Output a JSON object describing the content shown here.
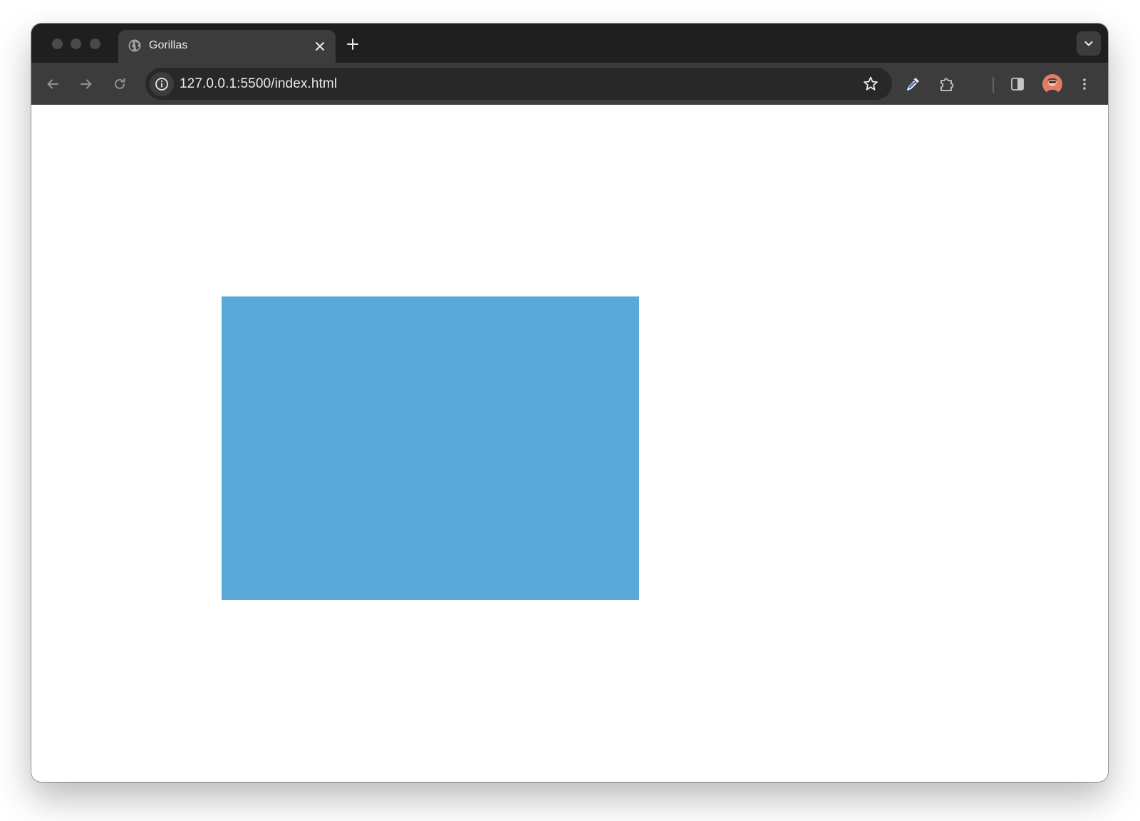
{
  "window": {
    "traffic_lights": [
      "close",
      "minimize",
      "maximize"
    ]
  },
  "tabs": [
    {
      "title": "Gorillas",
      "icon": "globe-icon",
      "active": true
    }
  ],
  "tabstrip": {
    "new_tab_icon": "plus-icon",
    "tab_search_icon": "chevron-down-icon"
  },
  "toolbar": {
    "back_icon": "arrow-left-icon",
    "forward_icon": "arrow-right-icon",
    "reload_icon": "reload-icon",
    "site_info_icon": "info-icon",
    "url": "127.0.0.1:5500/index.html",
    "bookmark_icon": "star-icon",
    "extensions": [
      "eyedropper-icon",
      "puzzle-icon"
    ],
    "side_panel_icon": "side-panel-icon",
    "profile": "avatar",
    "menu_icon": "kebab-menu-icon"
  },
  "page": {
    "canvas_color": "#58a8d8",
    "background": "#ffffff"
  },
  "colors": {
    "tabstrip": "#1f1f1f",
    "toolbar": "#3c3c3c",
    "omnibox": "#282828",
    "text": "#e8eaed",
    "icon": "#c4c7c5"
  }
}
